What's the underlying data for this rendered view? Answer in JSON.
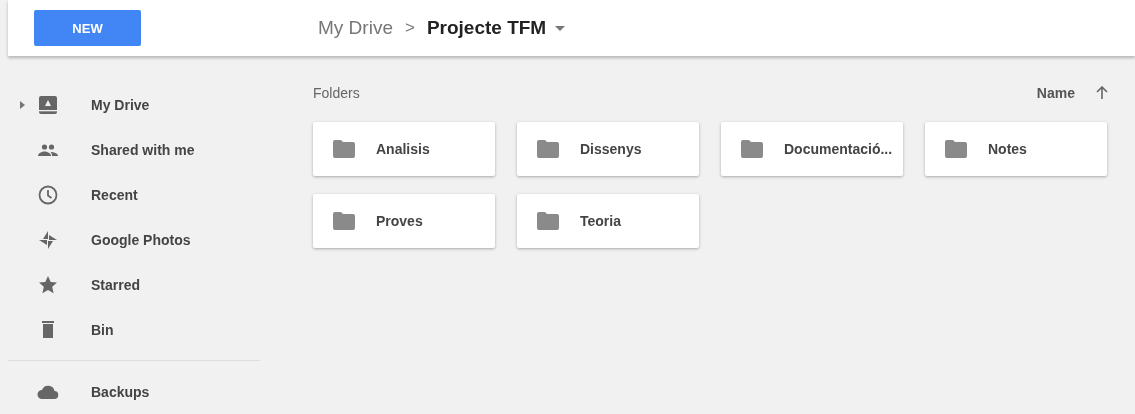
{
  "header": {
    "new_button": "NEW",
    "breadcrumb": {
      "parent": "My Drive",
      "separator": ">",
      "current": "Projecte TFM"
    }
  },
  "sidebar": {
    "items": [
      {
        "kind": "drive",
        "label": "My Drive",
        "expanded": false
      },
      {
        "kind": "shared",
        "label": "Shared with me"
      },
      {
        "kind": "recent",
        "label": "Recent"
      },
      {
        "kind": "photos",
        "label": "Google Photos"
      },
      {
        "kind": "starred",
        "label": "Starred"
      },
      {
        "kind": "bin",
        "label": "Bin"
      }
    ],
    "extra_items": [
      {
        "kind": "backups",
        "label": "Backups"
      }
    ]
  },
  "main": {
    "section_title": "Folders",
    "sort": {
      "label": "Name",
      "ascending": true
    },
    "folders": [
      {
        "name": "Analisis"
      },
      {
        "name": "Dissenys"
      },
      {
        "name": "Documentació..."
      },
      {
        "name": "Notes"
      },
      {
        "name": "Proves"
      },
      {
        "name": "Teoria"
      }
    ]
  }
}
